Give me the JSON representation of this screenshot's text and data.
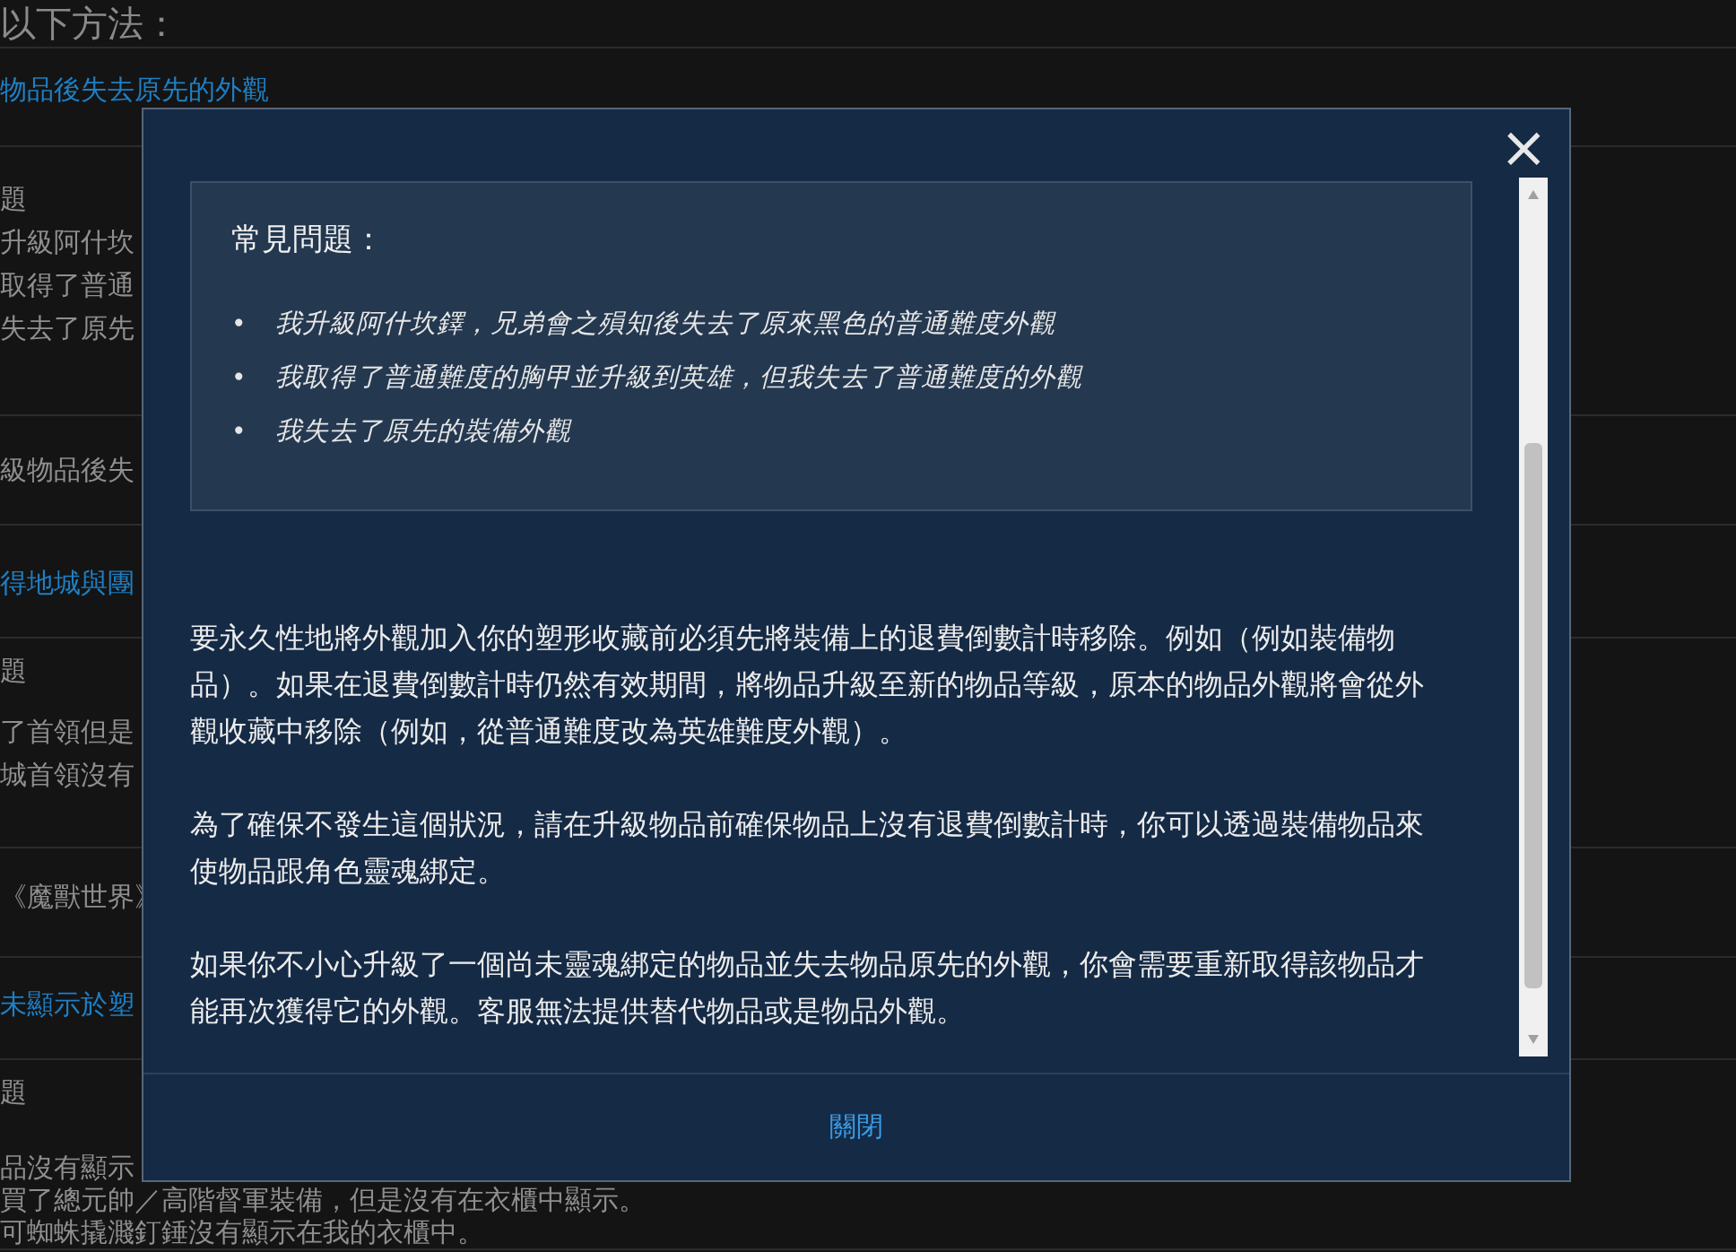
{
  "page": {
    "heading": "以下方法：",
    "sections": [
      {
        "kind": "link",
        "lines": [
          "物品後失去原先的外觀"
        ]
      },
      {
        "kind": "label",
        "lines": [
          "題"
        ]
      },
      {
        "kind": "text",
        "lines": [
          "升級阿什坎",
          "取得了普通",
          "失去了原先"
        ]
      },
      {
        "kind": "text",
        "lines": [
          "級物品後失"
        ]
      },
      {
        "kind": "link",
        "lines": [
          "得地城與團"
        ]
      },
      {
        "kind": "label",
        "lines": [
          "題"
        ]
      },
      {
        "kind": "text",
        "lines": [
          "了首領但是",
          "城首領沒有"
        ]
      },
      {
        "kind": "text",
        "lines": [
          "《魔獸世界》"
        ]
      },
      {
        "kind": "link",
        "lines": [
          "未顯示於塑"
        ]
      },
      {
        "kind": "label",
        "lines": [
          "題"
        ]
      },
      {
        "kind": "text",
        "lines": [
          "品沒有顯示",
          "買了總元帥／高階督軍裝備，但是沒有在衣櫃中顯示。",
          "可蜘蛛撬濺釘錘沒有顯示在我的衣櫃中。"
        ]
      }
    ]
  },
  "dialog": {
    "close": "×",
    "faq": {
      "title": "常見問題：",
      "bullet": "•",
      "items": [
        "我升級阿什坎鐸，兄弟會之殞知後失去了原來黑色的普通難度外觀",
        "我取得了普通難度的胸甲並升級到英雄，但我失去了普通難度的外觀",
        "我失去了原先的裝備外觀"
      ]
    },
    "paragraphs": [
      "要永久性地將外觀加入你的塑形收藏前必須先將裝備上的退費倒數計時移除。例如（例如裝備物品）。如果在退費倒數計時仍然有效期間，將物品升級至新的物品等級，原本的物品外觀將會從外觀收藏中移除（例如，從普通難度改為英雄難度外觀）。",
      "為了確保不發生這個狀況，請在升級物品前確保物品上沒有退費倒數計時，你可以透過裝備物品來使物品跟角色靈魂綁定。",
      "如果你不小心升級了一個尚未靈魂綁定的物品並失去物品原先的外觀，你會需要重新取得該物品才能再次獲得它的外觀。客服無法提供替代物品或是物品外觀。"
    ],
    "footer_button": "關閉"
  }
}
